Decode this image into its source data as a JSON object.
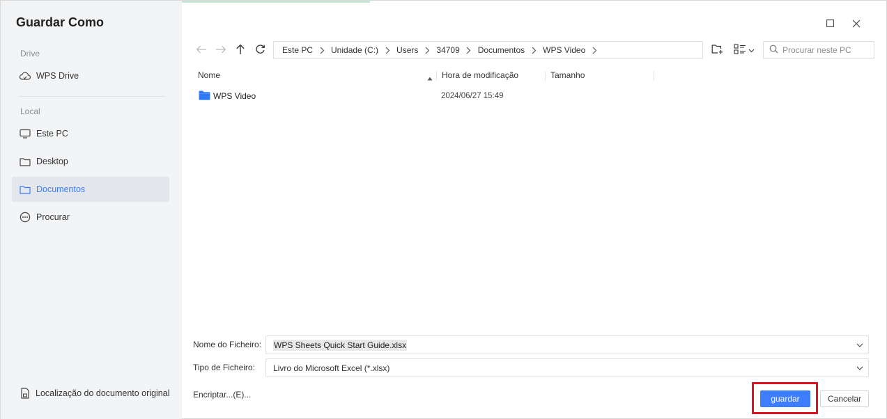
{
  "dialog": {
    "title": "Guardar Como"
  },
  "sidebar": {
    "drive_label": "Drive",
    "drive_items": [
      {
        "label": "WPS Drive",
        "icon": "cloud-icon"
      }
    ],
    "local_label": "Local",
    "local_items": [
      {
        "label": "Este PC",
        "icon": "monitor-icon"
      },
      {
        "label": "Desktop",
        "icon": "folder-icon"
      },
      {
        "label": "Documentos",
        "icon": "folder-icon",
        "active": true
      },
      {
        "label": "Procurar",
        "icon": "more-icon"
      }
    ],
    "bottom_item": {
      "label": "Localização do documento original",
      "icon": "document-icon"
    }
  },
  "toolbar": {
    "breadcrumb": [
      "Este PC",
      "Unidade (C:)",
      "Users",
      "34709",
      "Documentos",
      "WPS Video"
    ],
    "search_placeholder": "Procurar neste PC"
  },
  "file_list": {
    "columns": {
      "name": "Nome",
      "modified": "Hora de modificação",
      "size": "Tamanho"
    },
    "rows": [
      {
        "name": "WPS Video",
        "modified": "2024/06/27 15:49",
        "size": "",
        "type": "folder"
      }
    ]
  },
  "form": {
    "filename_label": "Nome do Ficheiro:",
    "filename_value": "WPS Sheets Quick Start Guide.xlsx",
    "filetype_label": "Tipo de Ficheiro:",
    "filetype_value": "Livro do Microsoft Excel (*.xlsx)",
    "encrypt_label": "Encriptar...(E)..."
  },
  "buttons": {
    "save": "guardar",
    "cancel": "Cancelar"
  },
  "colors": {
    "accent": "#3d7eff",
    "highlight": "#e0121e",
    "sidebar_bg": "#f3f4f6",
    "folder": "#2f7bf5"
  }
}
